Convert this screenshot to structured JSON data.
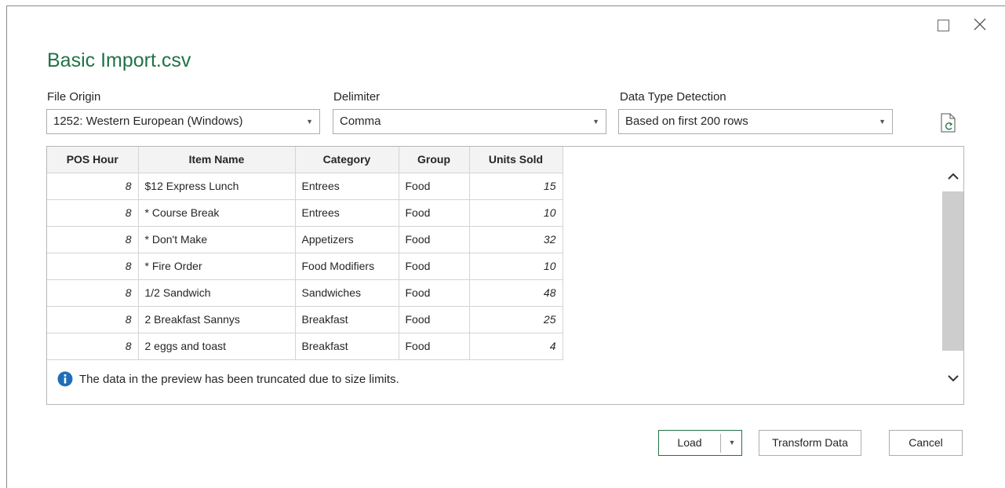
{
  "dialog": {
    "title": "Basic Import.csv"
  },
  "window_controls": {
    "maximize_icon": "maximize-icon",
    "close_icon": "close-icon"
  },
  "options": {
    "file_origin": {
      "label": "File Origin",
      "value": "1252: Western European (Windows)"
    },
    "delimiter": {
      "label": "Delimiter",
      "value": "Comma"
    },
    "data_type_detection": {
      "label": "Data Type Detection",
      "value": "Based on first 200 rows"
    },
    "refresh_icon": "refresh-icon"
  },
  "preview": {
    "columns": [
      "POS Hour",
      "Item Name",
      "Category",
      "Group",
      "Units Sold"
    ],
    "rows": [
      [
        "8",
        "$12 Express Lunch",
        "Entrees",
        "Food",
        "15"
      ],
      [
        "8",
        "* Course Break",
        "Entrees",
        "Food",
        "10"
      ],
      [
        "8",
        "* Don't Make",
        "Appetizers",
        "Food",
        "32"
      ],
      [
        "8",
        "* Fire Order",
        "Food Modifiers",
        "Food",
        "10"
      ],
      [
        "8",
        "1/2 Sandwich",
        "Sandwiches",
        "Food",
        "48"
      ],
      [
        "8",
        "2 Breakfast Sannys",
        "Breakfast",
        "Food",
        "25"
      ],
      [
        "8",
        "2 eggs and toast",
        "Breakfast",
        "Food",
        "4"
      ]
    ],
    "info_message": "The data in the preview has been truncated due to size limits."
  },
  "buttons": {
    "load": "Load",
    "transform": "Transform Data",
    "cancel": "Cancel"
  },
  "colors": {
    "accent": "#217346",
    "info_icon": "#1e6fb8"
  }
}
